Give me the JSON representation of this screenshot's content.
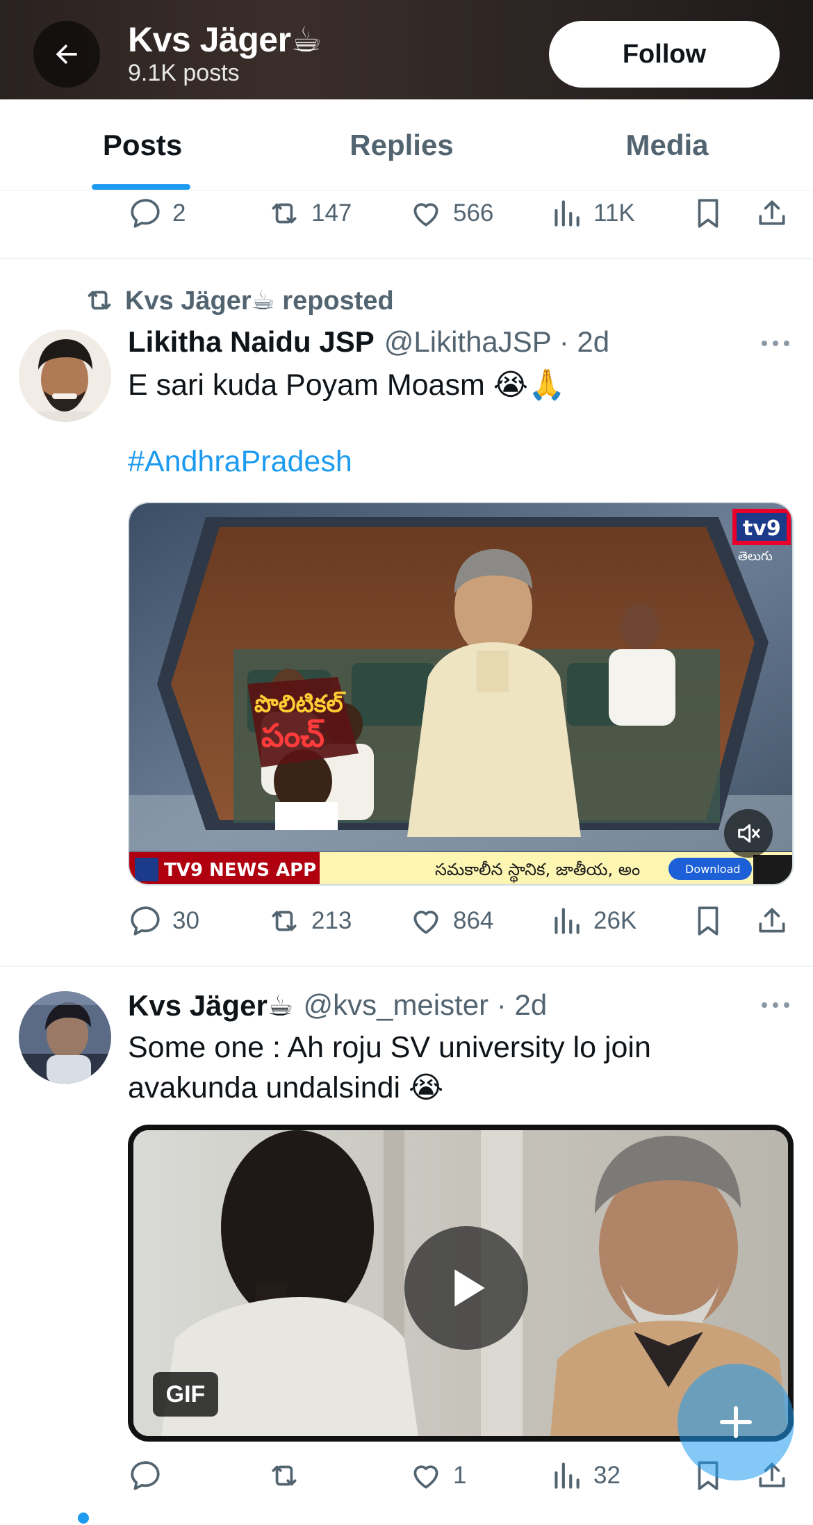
{
  "header": {
    "name": "Kvs Jäger☕",
    "posts_count": "9.1K posts",
    "follow_label": "Follow"
  },
  "tabs": [
    {
      "label": "Posts",
      "active": true
    },
    {
      "label": "Replies",
      "active": false
    },
    {
      "label": "Media",
      "active": false
    }
  ],
  "top_post_actions": {
    "replies": "2",
    "reposts": "147",
    "likes": "566",
    "views": "11K"
  },
  "post1": {
    "repost_text": "Kvs Jäger☕ reposted",
    "author_name": "Likitha Naidu JSP",
    "handle_time": "@LikithaJSP · 2d",
    "text": "E sari kuda Poyam Moasm 😭🙏",
    "hashtag": "#AndhraPradesh",
    "media": {
      "channel_logo": "tv9",
      "channel_lang": "తెలుగు",
      "show_title_line1": "పొలిటికల్",
      "show_title_line2": "పంచ్",
      "ticker_left": "TV9 NEWS APP",
      "ticker_right": "సమకాలీన స్థానిక, జాతీయ, అం",
      "ticker_download": "Download"
    },
    "actions": {
      "replies": "30",
      "reposts": "213",
      "likes": "864",
      "views": "26K"
    }
  },
  "post2": {
    "author_name": "Kvs Jäger☕",
    "handle_time": "@kvs_meister · 2d",
    "text_line1": "Some one :  Ah roju SV university lo join",
    "text_line2": "avakunda undalsindi 😭",
    "gif_label": "GIF",
    "actions": {
      "replies": "",
      "reposts": "",
      "likes": "1",
      "views": "32"
    }
  },
  "colors": {
    "accent": "#1d9bf0",
    "secondary_text": "#536471"
  }
}
